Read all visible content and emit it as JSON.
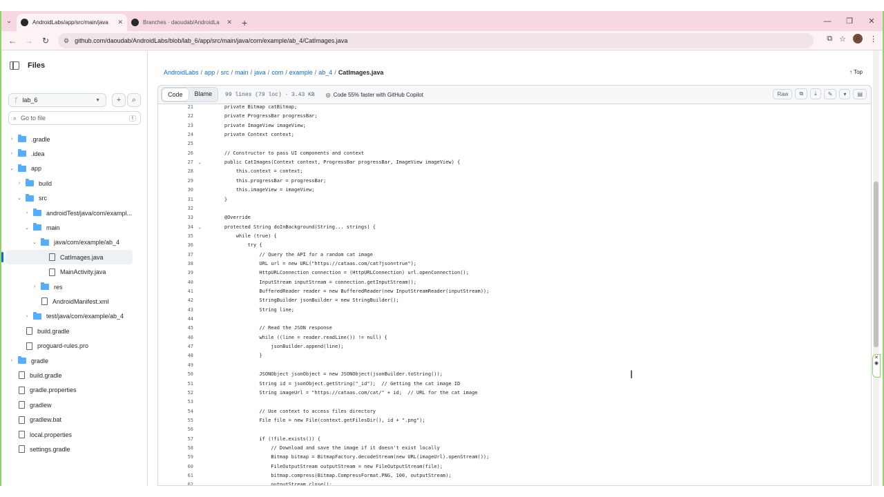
{
  "browser": {
    "tabs": [
      {
        "title": "AndroidLabs/app/src/main/java",
        "active": true
      },
      {
        "title": "Branches · daoudab/AndroidLa",
        "active": false
      }
    ],
    "url": "github.com/daoudab/AndroidLabs/blob/lab_6/app/src/main/java/com/example/ab_4/CatImages.java",
    "profile_initial": "A"
  },
  "sidebar": {
    "title": "Files",
    "branch": "lab_6",
    "search_placeholder": "Go to file",
    "search_key": "t",
    "tree": [
      {
        "label": ".gradle",
        "type": "folder",
        "depth": 0,
        "chev": "›"
      },
      {
        "label": ".idea",
        "type": "folder",
        "depth": 0,
        "chev": "›"
      },
      {
        "label": "app",
        "type": "folder",
        "depth": 0,
        "chev": "⌄"
      },
      {
        "label": "build",
        "type": "folder",
        "depth": 1,
        "chev": "›"
      },
      {
        "label": "src",
        "type": "folder",
        "depth": 1,
        "chev": "⌄"
      },
      {
        "label": "androidTest/java/com/exampl...",
        "type": "folder",
        "depth": 2,
        "chev": "›"
      },
      {
        "label": "main",
        "type": "folder",
        "depth": 2,
        "chev": "⌄"
      },
      {
        "label": "java/com/example/ab_4",
        "type": "folder",
        "depth": 3,
        "chev": "⌄"
      },
      {
        "label": "CatImages.java",
        "type": "file",
        "depth": 4,
        "chev": "",
        "selected": true
      },
      {
        "label": "MainActivity.java",
        "type": "file",
        "depth": 4,
        "chev": ""
      },
      {
        "label": "res",
        "type": "folder",
        "depth": 3,
        "chev": "›"
      },
      {
        "label": "AndroidManifest.xml",
        "type": "file",
        "depth": 3,
        "chev": ""
      },
      {
        "label": "test/java/com/example/ab_4",
        "type": "folder",
        "depth": 2,
        "chev": "›"
      },
      {
        "label": "build.gradle",
        "type": "file",
        "depth": 1,
        "chev": ""
      },
      {
        "label": "proguard-rules.pro",
        "type": "file",
        "depth": 1,
        "chev": ""
      },
      {
        "label": "gradle",
        "type": "folder",
        "depth": 0,
        "chev": "›"
      },
      {
        "label": "build.gradle",
        "type": "file",
        "depth": 0,
        "chev": ""
      },
      {
        "label": "gradle.properties",
        "type": "file",
        "depth": 0,
        "chev": ""
      },
      {
        "label": "gradlew",
        "type": "file",
        "depth": 0,
        "chev": ""
      },
      {
        "label": "gradlew.bat",
        "type": "file",
        "depth": 0,
        "chev": ""
      },
      {
        "label": "local.properties",
        "type": "file",
        "depth": 0,
        "chev": ""
      },
      {
        "label": "settings.gradle",
        "type": "file",
        "depth": 0,
        "chev": ""
      }
    ]
  },
  "breadcrumb": {
    "parts": [
      "AndroidLabs",
      "app",
      "src",
      "main",
      "java",
      "com",
      "example",
      "ab_4"
    ],
    "current": "CatImages.java",
    "top_label": "Top"
  },
  "file_header": {
    "code_tab": "Code",
    "blame_tab": "Blame",
    "meta": "99 lines (79 loc) · 3.43 KB",
    "copilot": "Code 55% faster with GitHub Copilot",
    "raw": "Raw"
  },
  "code": [
    {
      "n": "21",
      "f": "",
      "t": "    private Bitmap catBitmap;"
    },
    {
      "n": "22",
      "f": "",
      "t": "    private ProgressBar progressBar;"
    },
    {
      "n": "23",
      "f": "",
      "t": "    private ImageView imageView;"
    },
    {
      "n": "24",
      "f": "",
      "t": "    private Context context;"
    },
    {
      "n": "25",
      "f": "",
      "t": ""
    },
    {
      "n": "26",
      "f": "",
      "t": "    // Constructor to pass UI components and context"
    },
    {
      "n": "27",
      "f": "⌄",
      "t": "    public CatImages(Context context, ProgressBar progressBar, ImageView imageView) {"
    },
    {
      "n": "28",
      "f": "",
      "t": "        this.context = context;"
    },
    {
      "n": "29",
      "f": "",
      "t": "        this.progressBar = progressBar;"
    },
    {
      "n": "30",
      "f": "",
      "t": "        this.imageView = imageView;"
    },
    {
      "n": "31",
      "f": "",
      "t": "    }"
    },
    {
      "n": "32",
      "f": "",
      "t": ""
    },
    {
      "n": "33",
      "f": "",
      "t": "    @Override"
    },
    {
      "n": "34",
      "f": "⌄",
      "t": "    protected String doInBackground(String... strings) {"
    },
    {
      "n": "35",
      "f": "",
      "t": "        while (true) {"
    },
    {
      "n": "36",
      "f": "",
      "t": "            try {"
    },
    {
      "n": "37",
      "f": "",
      "t": "                // Query the API for a random cat image"
    },
    {
      "n": "38",
      "f": "",
      "t": "                URL url = new URL(\"https://cataas.com/cat?json=true\");"
    },
    {
      "n": "39",
      "f": "",
      "t": "                HttpURLConnection connection = (HttpURLConnection) url.openConnection();"
    },
    {
      "n": "40",
      "f": "",
      "t": "                InputStream inputStream = connection.getInputStream();"
    },
    {
      "n": "41",
      "f": "",
      "t": "                BufferedReader reader = new BufferedReader(new InputStreamReader(inputStream));"
    },
    {
      "n": "42",
      "f": "",
      "t": "                StringBuilder jsonBuilder = new StringBuilder();"
    },
    {
      "n": "43",
      "f": "",
      "t": "                String line;"
    },
    {
      "n": "44",
      "f": "",
      "t": ""
    },
    {
      "n": "45",
      "f": "",
      "t": "                // Read the JSON response"
    },
    {
      "n": "46",
      "f": "",
      "t": "                while ((line = reader.readLine()) != null) {"
    },
    {
      "n": "47",
      "f": "",
      "t": "                    jsonBuilder.append(line);"
    },
    {
      "n": "48",
      "f": "",
      "t": "                }"
    },
    {
      "n": "49",
      "f": "",
      "t": ""
    },
    {
      "n": "50",
      "f": "",
      "t": "                JSONObject jsonObject = new JSONObject(jsonBuilder.toString());"
    },
    {
      "n": "51",
      "f": "",
      "t": "                String id = jsonObject.getString(\"_id\");  // Getting the cat image ID"
    },
    {
      "n": "52",
      "f": "",
      "t": "                String imageUrl = \"https://cataas.com/cat/\" + id;  // URL for the cat image"
    },
    {
      "n": "53",
      "f": "",
      "t": ""
    },
    {
      "n": "54",
      "f": "",
      "t": "                // Use context to access files directory"
    },
    {
      "n": "55",
      "f": "",
      "t": "                File file = new File(context.getFilesDir(), id + \".png\");"
    },
    {
      "n": "56",
      "f": "",
      "t": ""
    },
    {
      "n": "57",
      "f": "",
      "t": "                if (!file.exists()) {"
    },
    {
      "n": "58",
      "f": "",
      "t": "                    // Download and save the image if it doesn't exist locally"
    },
    {
      "n": "59",
      "f": "",
      "t": "                    Bitmap bitmap = BitmapFactory.decodeStream(new URL(imageUrl).openStream());"
    },
    {
      "n": "60",
      "f": "",
      "t": "                    FileOutputStream outputStream = new FileOutputStream(file);"
    },
    {
      "n": "61",
      "f": "",
      "t": "                    bitmap.compress(Bitmap.CompressFormat.PNG, 100, outputStream);"
    },
    {
      "n": "62",
      "f": "",
      "t": "                    outputStream.close();"
    }
  ],
  "colors": {
    "link": "#0969da",
    "folder": "#54aeff",
    "tab_strip": "#f8d8e0"
  }
}
